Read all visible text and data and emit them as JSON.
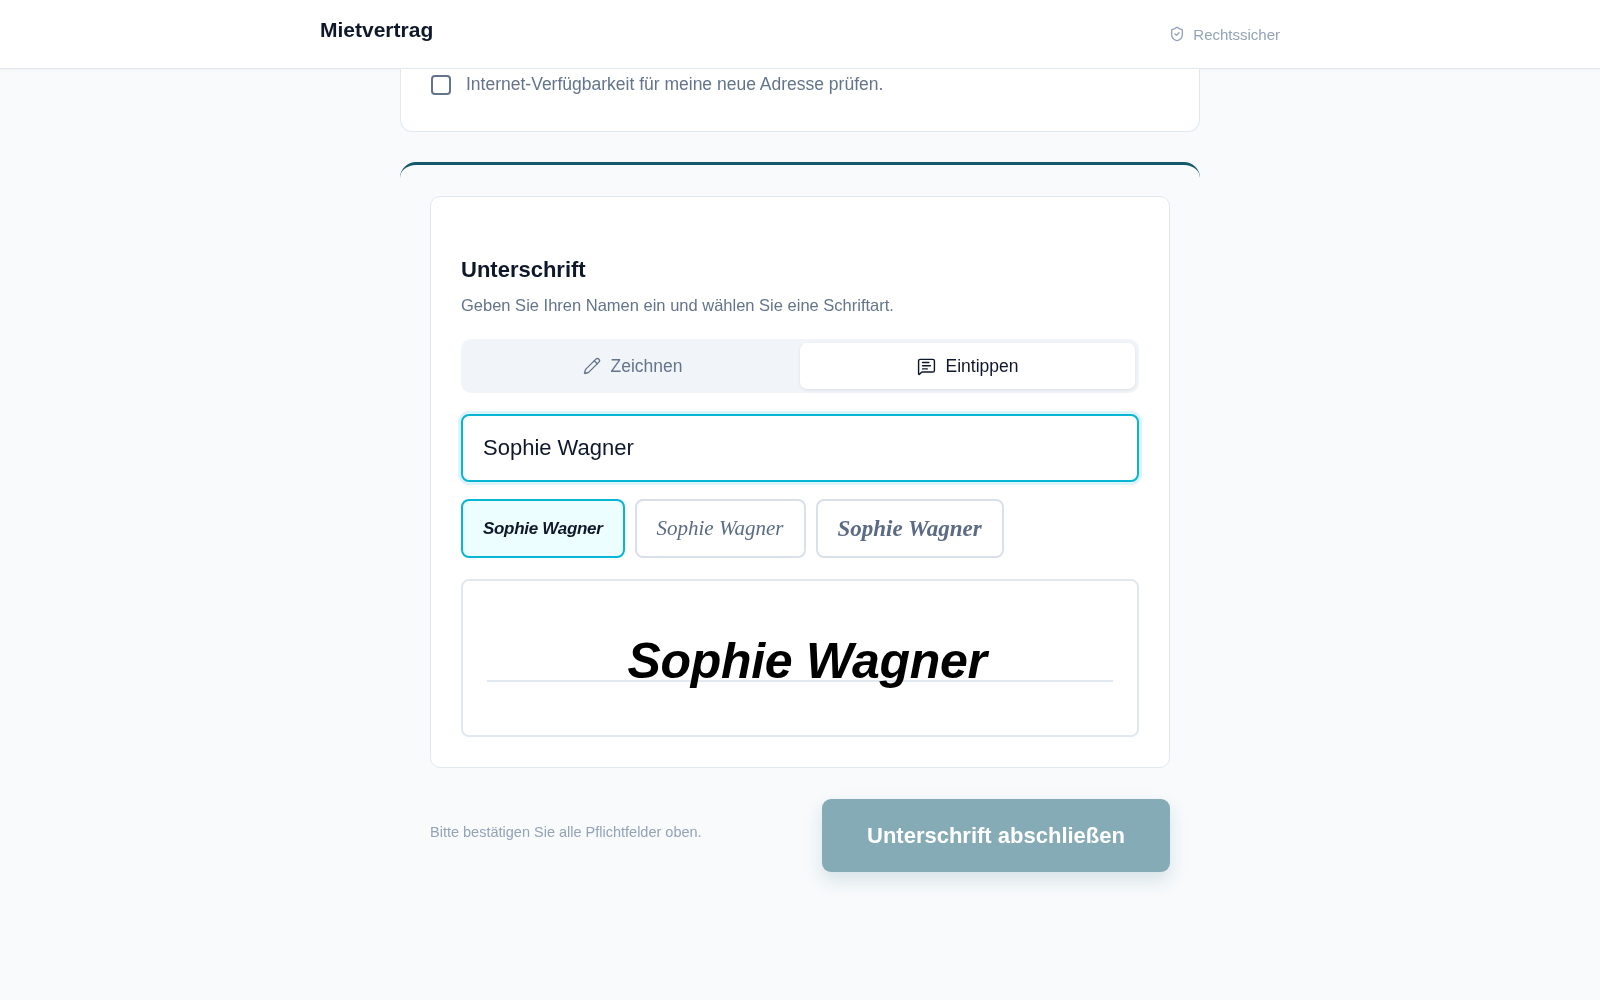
{
  "header": {
    "title": "Mietvertrag",
    "badge": "Rechtssicher"
  },
  "internet_check": {
    "label": "Internet-Verfügbarkeit für meine neue Adresse prüfen.",
    "checked": false
  },
  "signature": {
    "title": "Unterschrift",
    "description": "Geben Sie Ihren Namen ein und wählen Sie eine Schriftart.",
    "tabs": [
      {
        "kind": "draw",
        "label": "Zeichnen",
        "selected": false
      },
      {
        "kind": "type",
        "label": "Eintippen",
        "selected": true
      }
    ],
    "name_input": {
      "value": "Sophie Wagner",
      "focused": true
    },
    "font_options": [
      {
        "kind": "brush",
        "text": "Sophie Wagner",
        "selected": true
      },
      {
        "kind": "script",
        "text": "Sophie Wagner",
        "selected": false
      },
      {
        "kind": "bold",
        "text": "Sophie Wagner",
        "selected": false
      }
    ],
    "preview": {
      "text": "Sophie Wagner"
    }
  },
  "footer": {
    "hint": "Bitte bestätigen Sie alle Pflichtfelder oben.",
    "submit_button": {
      "label": "Unterschrift abschließen",
      "disabled": true
    }
  }
}
